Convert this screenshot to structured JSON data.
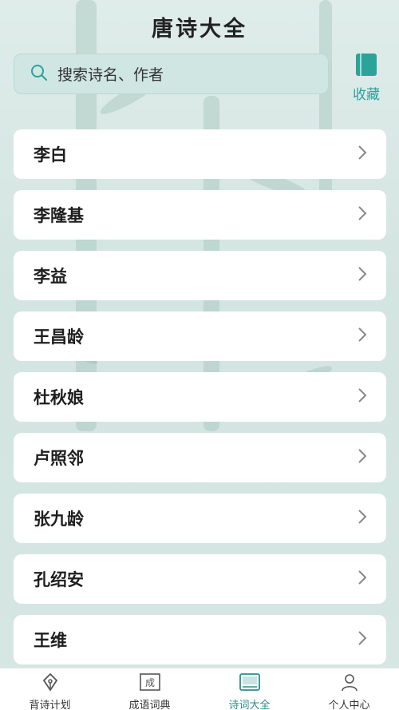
{
  "header": {
    "title": "唐诗大全"
  },
  "search": {
    "placeholder": "搜索诗名、作者"
  },
  "favorites": {
    "label": "收藏"
  },
  "authors": [
    {
      "name": "李白"
    },
    {
      "name": "李隆基"
    },
    {
      "name": "李益"
    },
    {
      "name": "王昌龄"
    },
    {
      "name": "杜秋娘"
    },
    {
      "name": "卢照邻"
    },
    {
      "name": "张九龄"
    },
    {
      "name": "孔绍安"
    },
    {
      "name": "王维"
    }
  ],
  "tabs": [
    {
      "label": "背诗计划",
      "icon": "pen-nib-icon"
    },
    {
      "label": "成语词典",
      "icon": "dictionary-icon",
      "glyph": "成"
    },
    {
      "label": "诗词大全",
      "icon": "book-icon",
      "active": true
    },
    {
      "label": "个人中心",
      "icon": "user-icon"
    }
  ],
  "colors": {
    "accent": "#2aa39a",
    "search_bg": "#cfe6e3",
    "background": "#d7e7e3"
  }
}
